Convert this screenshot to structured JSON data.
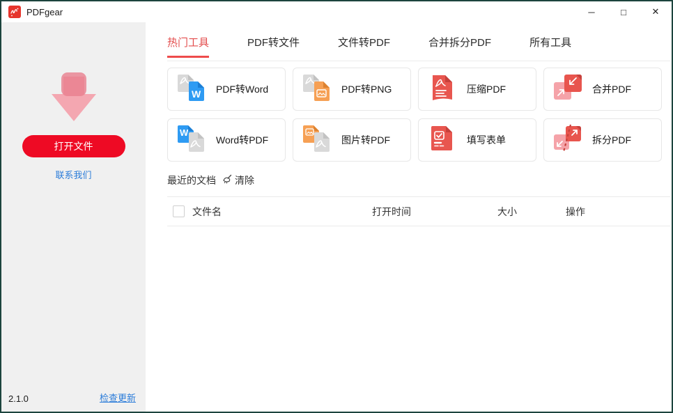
{
  "titlebar": {
    "app_title": "PDFgear"
  },
  "window_controls": {
    "minimize": "─",
    "maximize": "□",
    "close": "✕"
  },
  "sidebar": {
    "open_button": "打开文件",
    "contact_link": "联系我们",
    "version": "2.1.0",
    "check_update_link": "检查更新"
  },
  "tabs": [
    {
      "label": "热门工具",
      "active": true
    },
    {
      "label": "PDF转文件",
      "active": false
    },
    {
      "label": "文件转PDF",
      "active": false
    },
    {
      "label": "合并拆分PDF",
      "active": false
    },
    {
      "label": "所有工具",
      "active": false
    }
  ],
  "tools": [
    {
      "label": "PDF转Word",
      "icon": "pdf-to-word-icon"
    },
    {
      "label": "PDF转PNG",
      "icon": "pdf-to-png-icon"
    },
    {
      "label": "压缩PDF",
      "icon": "compress-pdf-icon"
    },
    {
      "label": "合并PDF",
      "icon": "merge-pdf-icon"
    },
    {
      "label": "Word转PDF",
      "icon": "word-to-pdf-icon"
    },
    {
      "label": "图片转PDF",
      "icon": "image-to-pdf-icon"
    },
    {
      "label": "填写表单",
      "icon": "fill-form-icon"
    },
    {
      "label": "拆分PDF",
      "icon": "split-pdf-icon"
    }
  ],
  "recent_documents": {
    "title": "最近的文档",
    "clear_label": "清除",
    "clear_icon": "broom-icon"
  },
  "table": {
    "headers": [
      "文件名",
      "打开时间",
      "大小",
      "操作"
    ],
    "rows": []
  },
  "colors": {
    "accent_red": "#ee0a24",
    "active_tab_red": "#e34d4d",
    "link_blue": "#2b7cd9",
    "sidebar_bg": "#f0f0f0",
    "icon_red": "#e8564f",
    "icon_pink": "#f5a3a9",
    "icon_blue": "#2e9bf3",
    "icon_orange": "#f6a054",
    "icon_grey": "#d9d9d9",
    "window_border": "#1c443d"
  }
}
